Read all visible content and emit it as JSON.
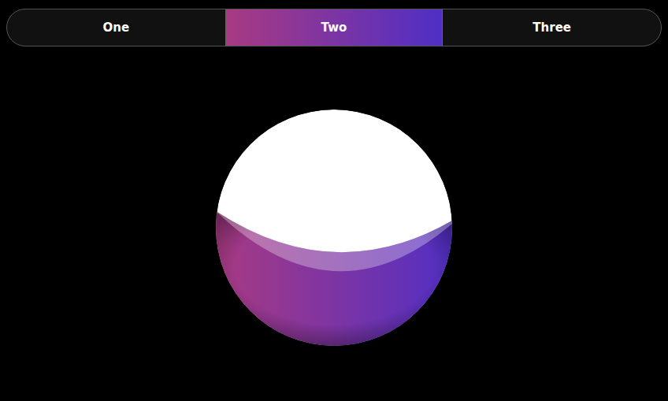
{
  "tabs": [
    {
      "label": "One",
      "selected": false
    },
    {
      "label": "Two",
      "selected": true
    },
    {
      "label": "Three",
      "selected": false
    }
  ],
  "globe": {
    "level": 0.45
  }
}
